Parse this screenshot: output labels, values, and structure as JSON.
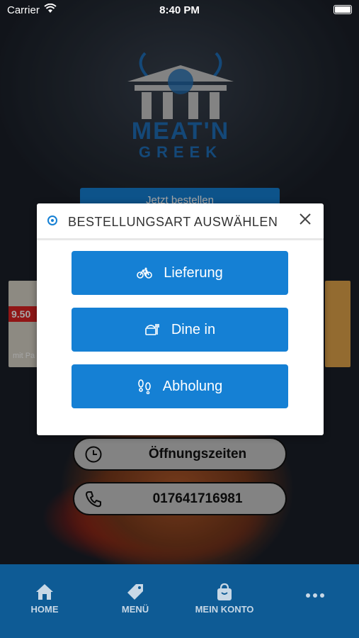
{
  "status_bar": {
    "carrier": "Carrier",
    "time": "8:40 PM"
  },
  "logo": {
    "line1": "MEAT'N",
    "line2": "GREEK"
  },
  "background": {
    "order_button_label": "Jetzt bestellen",
    "preview_price": "9.50",
    "preview_caption": "mit Pa"
  },
  "pills": {
    "hours_label": "Öffnungszeiten",
    "phone_number": "017641716981"
  },
  "modal": {
    "title": "BESTELLUNGSART AUSWÄHLEN",
    "options": [
      {
        "label": "Lieferung",
        "icon": "bicycle-icon"
      },
      {
        "label": "Dine in",
        "icon": "food-icon"
      },
      {
        "label": "Abholung",
        "icon": "footprints-icon"
      }
    ]
  },
  "tabbar": {
    "items": [
      {
        "label": "HOME",
        "icon": "home-icon"
      },
      {
        "label": "MENÜ",
        "icon": "tag-icon"
      },
      {
        "label": "MEIN KONTO",
        "icon": "bag-icon"
      },
      {
        "label": "",
        "icon": "more-icon"
      }
    ]
  },
  "colors": {
    "accent": "#1580d4",
    "tabbar": "#0e5b95",
    "logo": "#1f6fb8"
  }
}
